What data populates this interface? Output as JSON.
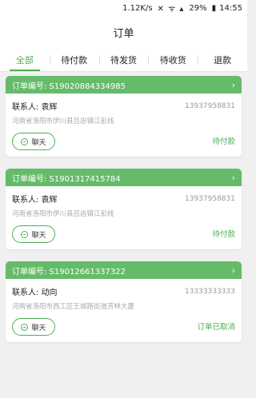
{
  "statusbar": {
    "speed": "1.12K/s",
    "icons": "✕ ᯤ ▴",
    "battery": "29%",
    "battery_icon": "▮",
    "time": "14:55"
  },
  "header": {
    "title": "订单"
  },
  "tabs": [
    {
      "label": "全部"
    },
    {
      "label": "待付款"
    },
    {
      "label": "待发货"
    },
    {
      "label": "待收货"
    },
    {
      "label": "退款"
    }
  ],
  "orders": [
    {
      "order_no": "订单编号: S19020884334985",
      "contact": "联系人: 袁辉",
      "phone": "13937958831",
      "address": "河南省洛阳市伊川县吕店镇江彭线",
      "chat_label": "聊天",
      "status": "待付款"
    },
    {
      "order_no": "订单编号: S1901317415784",
      "contact": "联系人: 袁辉",
      "phone": "13937958831",
      "address": "河南省洛阳市伊川县吕店镇江彭线",
      "chat_label": "聊天",
      "status": "待付款"
    },
    {
      "order_no": "订单编号: S19012661337322",
      "contact": "联系人: 动向",
      "phone": "13333333333",
      "address": "河南省洛阳市西工区王城路街道芳林大厦",
      "chat_label": "聊天",
      "status": "订单已取消"
    }
  ],
  "colors": {
    "accent": "#4caf50",
    "header_green": "#66bb6a"
  }
}
